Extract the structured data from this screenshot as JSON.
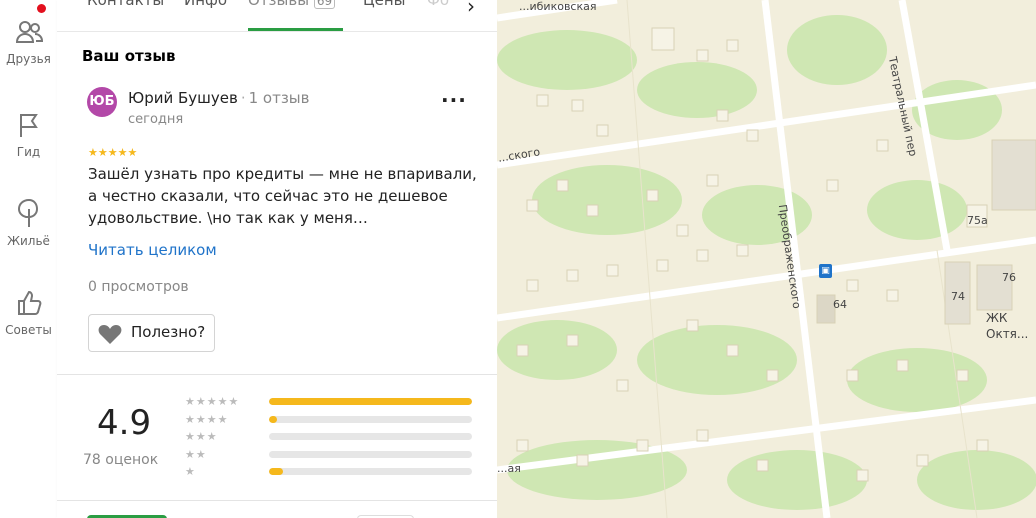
{
  "rail": {
    "friends": "Друзья",
    "guide": "Гид",
    "housing": "Жильё",
    "tips": "Советы"
  },
  "tabs": {
    "contacts": "Контакты",
    "info": "Инфо",
    "reviews": "Отзывы",
    "reviews_count": "69",
    "prices": "Цены",
    "photos": "Фо"
  },
  "review": {
    "section_title": "Ваш отзыв",
    "avatar_initials": "ЮБ",
    "author": "Юрий Бушуев",
    "author_reviews": "1 отзыв",
    "date": "сегодня",
    "rating": 5,
    "stars": "★★★★★",
    "text": "Зашёл узнать про кредиты — мне не впаривали, а честно сказали, что сейчас это не дешевое удовольствие. \\но так как у меня…",
    "read_more": "Читать целиком",
    "views": "0 просмотров",
    "useful": "Полезно?"
  },
  "summary": {
    "rating": "4.9",
    "count": "78 оценок",
    "distribution": [
      {
        "stars": "★★★★★",
        "fraction": 1.0
      },
      {
        "stars": "★★★★",
        "fraction": 0.04
      },
      {
        "stars": "★★★",
        "fraction": 0.0
      },
      {
        "stars": "★★",
        "fraction": 0.0
      },
      {
        "stars": "★",
        "fraction": 0.07
      }
    ]
  },
  "map": {
    "streets": [
      "...ибиковская",
      "...ского",
      "Театральный пер",
      "Преображенского",
      "...ая"
    ],
    "house_numbers": [
      "75а",
      "76",
      "74",
      "64"
    ],
    "poi": "ЖК Октя..."
  },
  "colors": {
    "accent_green": "#2a9d43",
    "link_blue": "#1f73c9",
    "star_yellow": "#f5b81c",
    "avatar": "#b348a8",
    "notification_red": "#e3101e"
  }
}
